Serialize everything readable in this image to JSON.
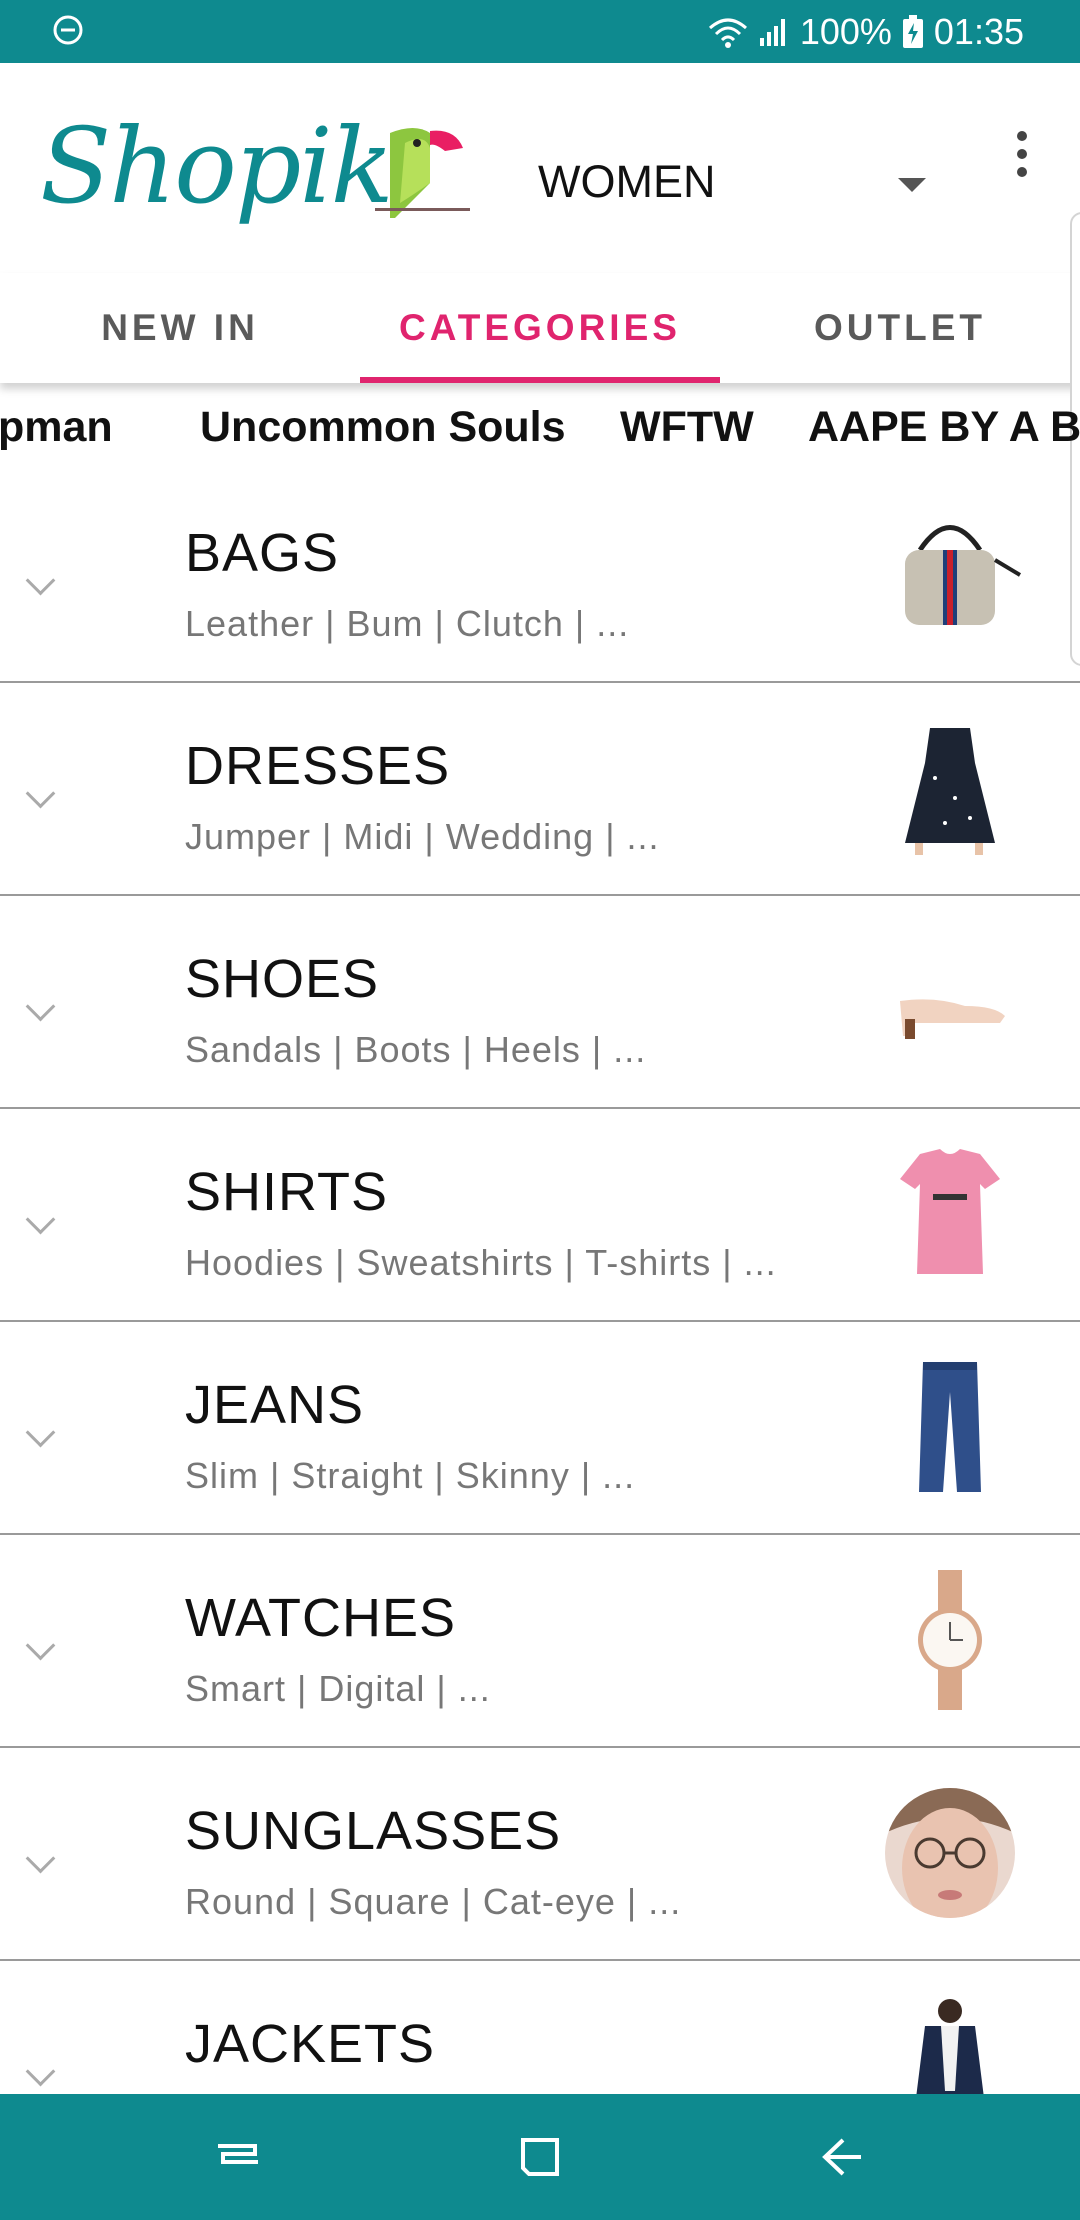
{
  "status_bar": {
    "battery": "100%",
    "time": "01:35"
  },
  "header": {
    "logo_text": "Shopik",
    "gender": "WOMEN"
  },
  "tabs": [
    {
      "label": "NEW IN",
      "active": false
    },
    {
      "label": "CATEGORIES",
      "active": true
    },
    {
      "label": "OUTLET",
      "active": false
    }
  ],
  "brands": [
    "pman",
    "Uncommon Souls",
    "WFTW",
    "AAPE BY A B"
  ],
  "categories": [
    {
      "title": "BAGS",
      "subtitle": "Leather | Bum | Clutch | ...",
      "icon": "handbag-image"
    },
    {
      "title": "DRESSES",
      "subtitle": "Jumper | Midi | Wedding | ...",
      "icon": "dress-image"
    },
    {
      "title": "SHOES",
      "subtitle": "Sandals | Boots | Heels | ...",
      "icon": "shoe-image"
    },
    {
      "title": "SHIRTS",
      "subtitle": "Hoodies | Sweatshirts | T-shirts | ...",
      "icon": "tshirt-image"
    },
    {
      "title": "JEANS",
      "subtitle": "Slim | Straight | Skinny | ...",
      "icon": "jeans-image"
    },
    {
      "title": "WATCHES",
      "subtitle": "Smart | Digital | ...",
      "icon": "watch-image"
    },
    {
      "title": "SUNGLASSES",
      "subtitle": "Round | Square | Cat-eye | ...",
      "icon": "glasses-model-image"
    },
    {
      "title": "JACKETS",
      "subtitle": "",
      "icon": "jacket-image"
    }
  ],
  "colors": {
    "brand_teal": "#0e8a8f",
    "accent_pink": "#e0246e"
  }
}
